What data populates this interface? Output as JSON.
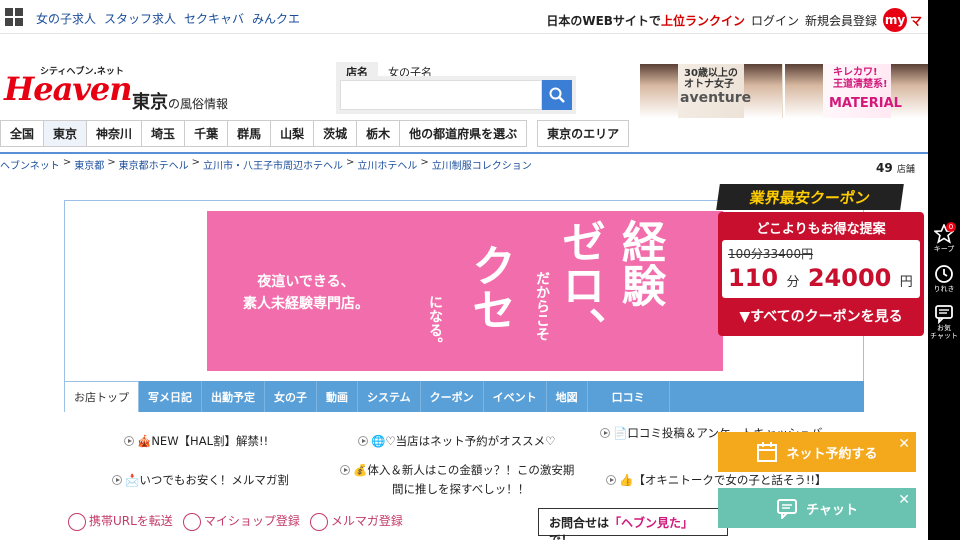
{
  "topbar": {
    "nav": [
      "女の子求人",
      "スタッフ求人",
      "セクキャバ",
      "みんクエ"
    ],
    "rank_prefix": "日本のWEBサイトで",
    "rank_highlight": "上位ランクイン",
    "login": "ログイン",
    "register": "新規会員登録",
    "my_label": "my",
    "my_text": "マ"
  },
  "header": {
    "logo_small": "シティヘブン.ネット",
    "logo_main": "Heaven",
    "region": "東京",
    "region_suffix": "の風俗情報",
    "search_tab_shop": "店名",
    "search_tab_girl": "女の子名",
    "search_placeholder": "",
    "banner1_t1": "30歳以上の\nオトナ女子",
    "banner1_t2": "aventure",
    "banner2_t1": "キレカワ!\n王道清楚系!",
    "banner2_t2": "MATERIAL"
  },
  "prefectures": [
    "全国",
    "東京",
    "神奈川",
    "埼玉",
    "千葉",
    "群馬",
    "山梨",
    "茨城",
    "栃木",
    "他の都道府県を選ぶ"
  ],
  "area_button": "東京のエリア",
  "breadcrumb": [
    "ヘブンネット",
    "東京都",
    "東京都ホテヘル",
    "立川市・八王子市周辺ホテヘル",
    "立川ホテヘル",
    "立川制服コレクション"
  ],
  "shop_count": "49",
  "shop_count_unit": "店舗",
  "hero": {
    "sub1": "夜這いできる、",
    "sub2": "素人未経験専門店。",
    "v1": "経験",
    "v2": "ゼロ、",
    "v3": "だからこそ",
    "v4": "クセ",
    "v5": "になる。"
  },
  "shop_tabs": [
    "お店トップ",
    "写メ日記",
    "出勤予定",
    "女の子",
    "動画",
    "システム",
    "クーポン",
    "イベント",
    "地図",
    "口コミ"
  ],
  "info_links": [
    "🎪NEW【HAL割】解禁!!",
    "🌐♡当店はネット予約がオススメ♡",
    "📄口コミ投稿＆アンケートキャッシュバ…",
    "📩いつでもお安く！メルマガ割",
    "💰体入＆新人はこの金額ッ？！この激安期",
    "間に推しを探すべしッ！！",
    "👍【オキニトークで女の子と話そう!!】"
  ],
  "util": [
    "携帯URLを転送",
    "マイショップ登録",
    "メルマガ登録"
  ],
  "contact": {
    "prefix": "お問合せは",
    "highlight": "「ヘブン見た」",
    "suffix": "で！"
  },
  "coupon": {
    "head": "業界最安クーポン",
    "title": "どこよりもお得な提案",
    "old": "100分33400円",
    "new_minutes": "110",
    "new_min_unit": "分",
    "new_price": "24000",
    "new_unit": "円",
    "link": "▼すべてのクーポンを見る"
  },
  "sidebar": {
    "keep": "キープ",
    "keep_badge": "0",
    "history": "りれき",
    "chat": "お気\nチャット"
  },
  "floating": {
    "reserve": "ネット予約する",
    "chat": "チャット",
    "reserve_color": "#f4a81c",
    "chat_color": "#6ac3b0"
  }
}
